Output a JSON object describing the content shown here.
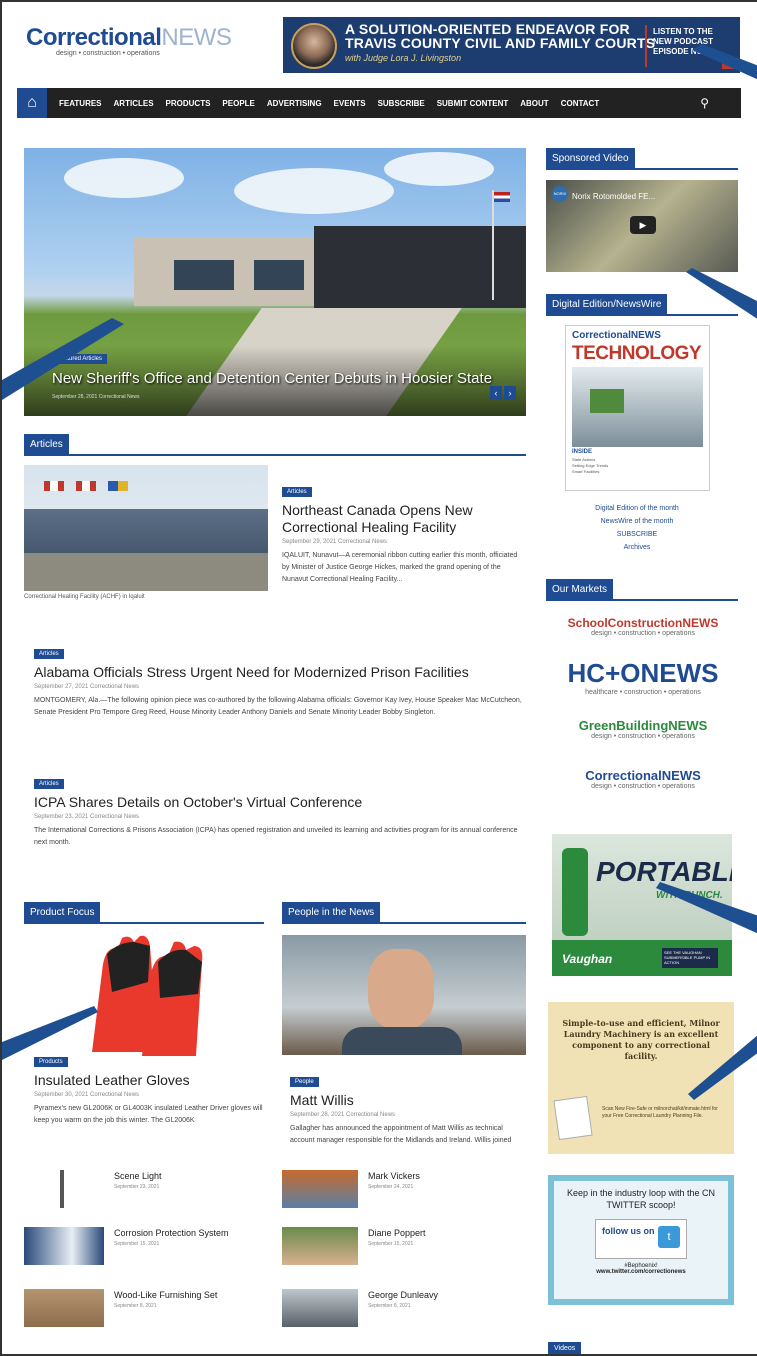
{
  "site": {
    "logo_main": "Correctional",
    "logo_news": "NEWS",
    "logo_tag": "design • construction • operations"
  },
  "banner": {
    "line1": "A SOLUTION-ORIENTED ENDEAVOR FOR",
    "line2": "TRAVIS COUNTY CIVIL AND FAMILY COURTS",
    "line3": "with Judge Lora J. Livingston",
    "listen": [
      "LISTEN TO THE",
      "NEW PODCAST",
      "EPISODE NOW!"
    ],
    "badge": "CN"
  },
  "nav": {
    "items": [
      "FEATURES",
      "ARTICLES",
      "PRODUCTS",
      "PEOPLE",
      "ADVERTISING",
      "EVENTS",
      "SUBSCRIBE",
      "SUBMIT CONTENT",
      "ABOUT",
      "CONTACT"
    ]
  },
  "hero": {
    "badge": "Featured Articles",
    "title": "New Sheriff's Office and Detention Center Debuts in Hoosier State",
    "meta": "September 28, 2021   Correctional News"
  },
  "articles": {
    "heading": "Articles",
    "list": [
      {
        "cat": "Articles",
        "title": "Northeast Canada Opens New Correctional Healing Facility",
        "meta": "September 29, 2021   Correctional News",
        "excerpt": "IQALUIT, Nunavut—A ceremonial ribbon cutting earlier this month, officiated by Minister of Justice George Hickes, marked the grand opening of the Nunavut Correctional Healing Facility...",
        "caption": "Correctional Healing Facility (ACHF) in Iqaluit"
      },
      {
        "cat": "Articles",
        "title": "Alabama Officials Stress Urgent Need for Modernized Prison Facilities",
        "meta": "September 27, 2021   Correctional News",
        "excerpt": "MONTGOMERY, Ala.—The following opinion piece was co-authored by the following Alabama officials: Governor Kay Ivey, House Speaker Mac McCutcheon, Senate President Pro Tempore Greg Reed, House Minority Leader Anthony Daniels and Senate Minority Leader Bobby Singleton."
      },
      {
        "cat": "Articles",
        "title": "ICPA Shares Details on October's Virtual Conference",
        "meta": "September 23, 2021   Correctional News",
        "excerpt": "The International Corrections & Prisons Association (ICPA) has opened registration and unveiled its learning and activities program for its annual conference next month."
      }
    ]
  },
  "product_focus": {
    "heading": "Product Focus",
    "cat": "Products",
    "title": "Insulated Leather Gloves",
    "meta": "September 30, 2021   Correctional News",
    "excerpt": "Pyramex's new GL2006K or GL4003K insulated Leather Driver gloves will keep you warm on the job this winter. The GL2006K",
    "items": [
      {
        "name": "Scene Light",
        "date": "September 23, 2021"
      },
      {
        "name": "Corrosion Protection System",
        "date": "September 15, 2021"
      },
      {
        "name": "Wood-Like Furnishing Set",
        "date": "September 8, 2021"
      }
    ]
  },
  "people": {
    "heading": "People in the News",
    "cat": "People",
    "title": "Matt Willis",
    "meta": "September 28, 2021   Correctional News",
    "excerpt": "Gallagher has announced the appointment of Matt Willis as technical account manager responsible for the Midlands and Ireland. Willis joined",
    "items": [
      {
        "name": "Mark Vickers",
        "date": "September 24, 2021"
      },
      {
        "name": "Diane Poppert",
        "date": "September 15, 2021"
      },
      {
        "name": "George Dunleavy",
        "date": "September 8, 2021"
      }
    ]
  },
  "sidebar": {
    "sponsored_heading": "Sponsored Video",
    "video_title": "Norix Rotomolded FE...",
    "video_logo": "NORIX",
    "digital_heading": "Digital Edition/NewsWire",
    "mag_logo": "CorrectionalNEWS",
    "mag_title": "TECHNOLOGY",
    "mag_inside": "INSIDE",
    "mag_lines": [
      "State Actions",
      "Setting Edge Trends",
      "Smart Facilities"
    ],
    "digital_links": [
      "Digital Edition of the month",
      "NewsWire of the month",
      "SUBSCRIBE",
      "Archives"
    ],
    "markets_heading": "Our Markets",
    "markets": [
      {
        "name": "SchoolConstructionNEWS",
        "sub": "design • construction • operations",
        "color": "#c0382b"
      },
      {
        "name": "HC+ONEWS",
        "sub": "healthcare • construction • operations",
        "color": "#1e4b91"
      },
      {
        "name": "GreenBuildingNEWS",
        "sub": "design • construction • operations",
        "color": "#2c8a3d"
      },
      {
        "name": "CorrectionalNEWS",
        "sub": "design • construction • operations",
        "color": "#1e4b91"
      }
    ],
    "ad1_title": "PORTABLE",
    "ad1_sub": "WITH PUNCH.",
    "ad1_logo": "Vaughan",
    "ad1_cta": "SEE THE VAUGHAN SUBMERSIBLE PUMP IN ACTION",
    "ad2_text": "Simple-to-use and efficient, Milnor Laundry Machinery is an excellent component to any correctional facility.",
    "ad2_small": "Scan New Fire-Safe or milnorchat/kit/inmate.html for your Free Correctional Laundry Planning File.",
    "ad3_text": "Keep in the industry loop with the CN TWITTER scoop!",
    "ad3_follow": "follow us on",
    "ad3_handle": "#Bephoenix!",
    "ad3_url": "www.twitter.com/correctionews",
    "videos_label": "Videos"
  }
}
